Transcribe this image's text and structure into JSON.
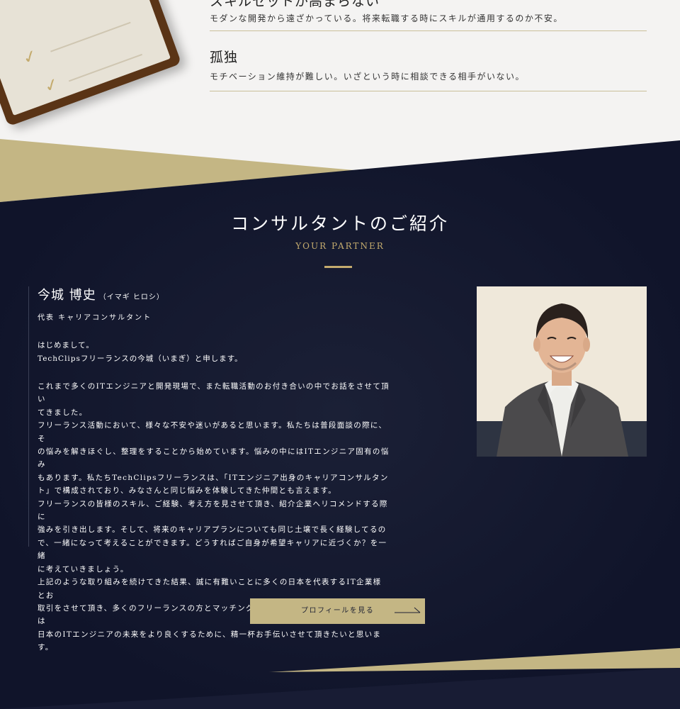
{
  "worries": [
    {
      "title": "スキルセットが高まらない",
      "desc": "モダンな開発から遠ざかっている。将来転職する時にスキルが通用するのか不安。"
    },
    {
      "title": "孤独",
      "desc": "モチベーション維持が難しい。いざという時に相談できる相手がいない。"
    }
  ],
  "consultant_section": {
    "title": "コンサルタントのご紹介",
    "subtitle": "YOUR PARTNER",
    "name": "今城 博史",
    "name_kana": "（イマギ ヒロシ）",
    "role": "代表 キャリアコンサルタント",
    "greeting": "はじめまして。\nTechClipsフリーランスの今城（いまぎ）と申します。",
    "bio": "これまで多くのITエンジニアと開発現場で、また転職活動のお付き合いの中でお話をさせて頂い\nてきました。\nフリーランス活動において、様々な不安や迷いがあると思います。私たちは普段面談の際に、そ\nの悩みを解きほぐし、整理をすることから始めています。悩みの中にはITエンジニア固有の悩み\nもあります。私たちTechClipsフリーランスは、「ITエンジニア出身のキャリアコンサルタン\nト」で構成されており、みなさんと同じ悩みを体験してきた仲間とも言えます。\nフリーランスの皆様のスキル、ご経験、考え方を見させて頂き、紹介企業へリコメンドする際に\n強みを引き出します。そして、将来のキャリアプランについても同じ土壌で長く経験してるの\nで、一緒になって考えることができます。どうすればご自身が希望キャリアに近づくか？を一緒\nに考えていきましょう。\n上記のような取り組みを続けてきた結果、誠に有難いことに多くの日本を代表するIT企業様とお\n取引をさせて頂き、多くのフリーランスの方とマッチングをしてきました。これからも私たちは\n日本のITエンジニアの未来をより良くするために、精一杯お手伝いさせて頂きたいと思います。",
    "button_label": "プロフィールを見る"
  },
  "icons": {
    "clipboard": "clipboard-illustration",
    "arrow": "long-arrow-right-icon",
    "photo": "consultant-portrait"
  },
  "colors": {
    "navy": "#121629",
    "gold": "#c4ab6e",
    "button_gold": "#c4b684",
    "light_bg": "#f4f3f2"
  }
}
